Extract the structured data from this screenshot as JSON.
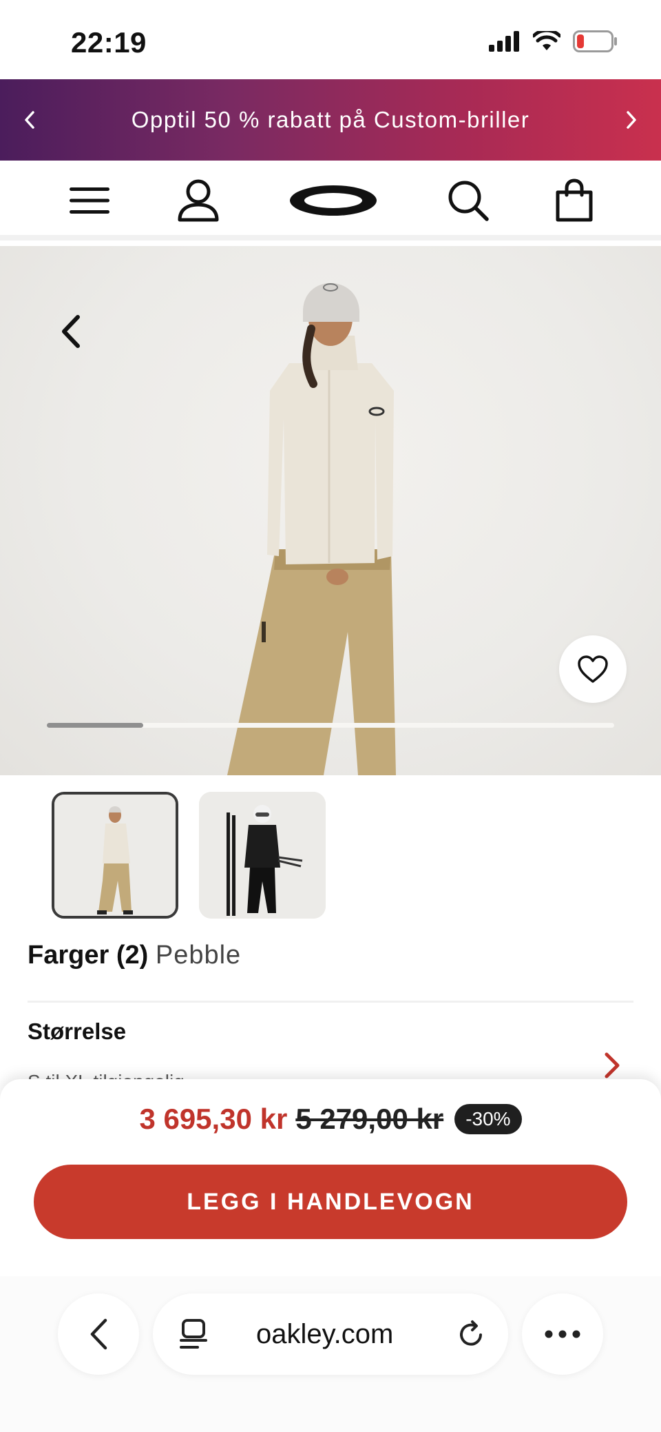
{
  "status_bar": {
    "time": "22:19"
  },
  "promo": {
    "text": "Opptil 50 % rabatt på Custom-briller"
  },
  "product": {
    "colors_label": "Farger (2)",
    "selected_color": "Pebble",
    "size_label": "Størrelse",
    "size_hint": "S til XL tilgjengelig"
  },
  "gallery": {
    "progress_fraction": 0.17
  },
  "pricing": {
    "price": "3 695,30 kr",
    "original_price": "5 279,00 kr",
    "discount": "-30%"
  },
  "cta": {
    "label": "LEGG I HANDLEVOGN"
  },
  "browser": {
    "url": "oakley.com"
  },
  "colors": {
    "brand_red": "#c83a2c",
    "price_red": "#c0342b",
    "banner_start": "#4b1d5c",
    "banner_end": "#c9304e"
  },
  "icons": [
    "chevron-left-icon",
    "chevron-right-icon",
    "menu-icon",
    "account-icon",
    "oakley-logo",
    "search-icon",
    "bag-icon",
    "heart-icon",
    "tabs-icon",
    "reload-icon",
    "more-icon"
  ]
}
